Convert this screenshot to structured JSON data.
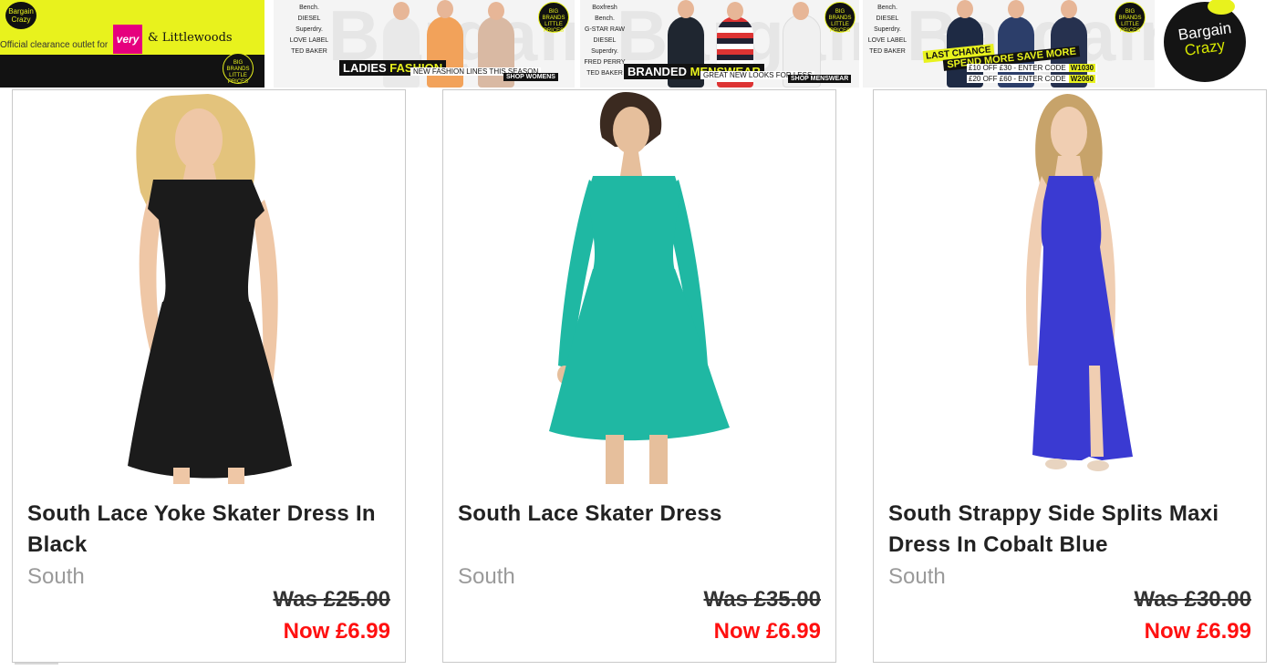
{
  "banner": {
    "outlet": {
      "logo_line1": "Bargain",
      "logo_line2": "Crazy",
      "tagline": "Official clearance outlet for",
      "very": "very",
      "littlewoods": "& Littlewoods",
      "badge": "BIG BRANDS LITTLE PRICES"
    },
    "brands": [
      "Bench.",
      "DIESEL",
      "Superdry.",
      "LOVE LABEL",
      "TED BAKER"
    ],
    "brands_men": [
      "Boxfresh",
      "Bench.",
      "G-STAR RAW",
      "DIESEL",
      "Superdry.",
      "FRED PERRY",
      "TED BAKER"
    ],
    "ladies": {
      "ghost": "Bargain",
      "tag_plain": "LADIES",
      "tag_highlight": "FASHION",
      "sub": "NEW FASHION LINES THIS SEASON",
      "shop": "SHOP WOMENS"
    },
    "mens": {
      "ghost": "Bargain",
      "tag_plain": "BRANDED",
      "tag_highlight": "MENSWEAR",
      "sub": "GREAT NEW LOOKS FOR LESS",
      "shop": "SHOP MENSWEAR"
    },
    "offer": {
      "ghost": "Bargain",
      "last_chance": "LAST CHANCE",
      "spend_more": "SPEND MORE SAVE MORE",
      "line1": "£10 OFF £30 - ENTER CODE",
      "code1": "W1030",
      "line2": "£20 OFF £60 - ENTER CODE",
      "code2": "W2060"
    },
    "crazy_logo": {
      "line1": "Bargain",
      "line2": "Crazy"
    },
    "colors": {
      "yellow": "#e8f21d",
      "very_pink": "#e6007e",
      "dark": "#111111"
    }
  },
  "products": [
    {
      "title": "South Lace Yoke Skater Dress In Black",
      "brand": "South",
      "was": "Was £25.00",
      "now": "Now £6.99",
      "dress_color": "#1b1b1b"
    },
    {
      "title": "South Lace Skater Dress",
      "brand": "South",
      "was": "Was £35.00",
      "now": "Now £6.99",
      "dress_color": "#1fb8a3"
    },
    {
      "title": "South Strappy Side Splits Maxi Dress In Cobalt Blue",
      "brand": "South",
      "was": "Was £30.00",
      "now": "Now £6.99",
      "dress_color": "#3a3ad2"
    }
  ],
  "price_colors": {
    "now": "#ff1010",
    "was": "#333333"
  }
}
